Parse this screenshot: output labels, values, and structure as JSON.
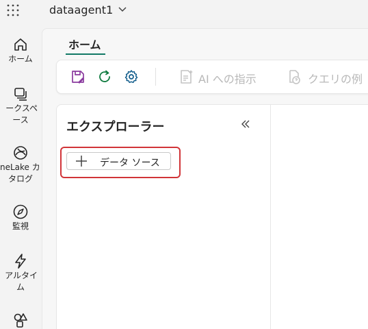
{
  "app": {
    "title": "dataagent1"
  },
  "rail": {
    "items": [
      {
        "label_lines": [
          "ホーム"
        ],
        "icon": "home-icon"
      },
      {
        "label_lines": [
          "ークスペ",
          "ース"
        ],
        "icon": "workspaces-icon"
      },
      {
        "label_lines": [
          "neLake カ",
          "タログ"
        ],
        "icon": "onelake-catalog-icon"
      },
      {
        "label_lines": [
          "監視"
        ],
        "icon": "monitor-icon"
      },
      {
        "label_lines": [
          "アルタイ",
          "ム"
        ],
        "icon": "realtime-icon"
      },
      {
        "label_lines": [
          ""
        ],
        "icon": "shapes-icon"
      }
    ]
  },
  "tabs": {
    "home": "ホーム"
  },
  "toolbar": {
    "save_icon": "save-icon",
    "refresh_icon": "refresh-icon",
    "settings_icon": "settings-icon",
    "ai_instructions": "AI への指示",
    "example_queries": "クエリの例"
  },
  "explorer": {
    "title": "エクスプローラー",
    "add_data_source": "データ ソース"
  },
  "colors": {
    "accent": "#117865",
    "save_icon": "#8a3a9e",
    "refresh_icon": "#0f7b3f",
    "settings_icon": "#0f5b8a",
    "highlight": "#d13438"
  }
}
